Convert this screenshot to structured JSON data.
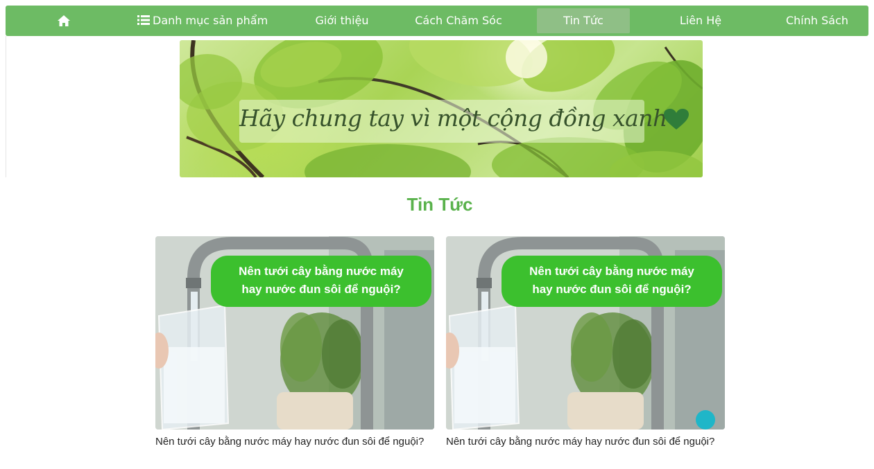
{
  "nav": {
    "home_icon": "home-icon",
    "menu_icon": "list-icon",
    "items": [
      {
        "label": "Danh mục sản phẩm"
      },
      {
        "label": "Giới thiệu"
      },
      {
        "label": "Cách Chăm Sóc"
      },
      {
        "label": "Tin Tức",
        "active": true
      },
      {
        "label": "Liên Hệ"
      },
      {
        "label": "Chính Sách"
      }
    ]
  },
  "banner": {
    "slogan": "Hãy chung tay vì một cộng đồng xanh",
    "heart_icon": "heart-icon",
    "heart_color": "#2f7d3a"
  },
  "section": {
    "title": "Tin Tức"
  },
  "articles": [
    {
      "image_caption_line1": "Nên tưới cây bằng nước máy",
      "image_caption_line2": "hay nước đun sôi để nguội?",
      "title": "Nên tưới cây bằng nước máy hay nước đun sôi để nguội?"
    },
    {
      "image_caption_line1": "Nên tưới cây bằng nước máy",
      "image_caption_line2": "hay nước đun sôi để nguội?",
      "title": "Nên tưới cây bằng nước máy hay nước đun sôi để nguội?"
    }
  ],
  "colors": {
    "nav_bg": "#6dbb64",
    "title_green": "#5ab24c",
    "bubble_green": "#3cc02e",
    "scroll_button": "#1fb6c8"
  }
}
